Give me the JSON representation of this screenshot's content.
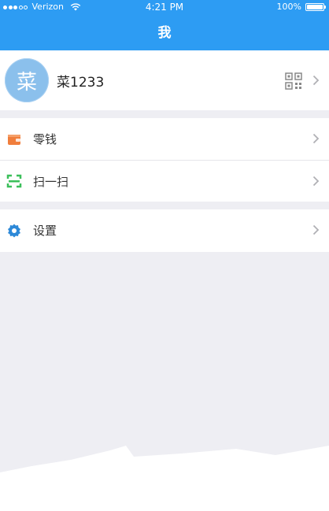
{
  "status_bar": {
    "carrier": "Verizon",
    "time": "4:21 PM",
    "battery": "100%"
  },
  "nav": {
    "title": "我"
  },
  "profile": {
    "avatar_text": "菜",
    "username": "菜1233",
    "qr_icon": "qr-code-icon"
  },
  "menu": {
    "wallet": {
      "label": "零钱",
      "icon": "wallet-icon",
      "color": "#f07e3c"
    },
    "scan": {
      "label": "扫一扫",
      "icon": "scan-icon",
      "color": "#3bbf5a"
    },
    "settings": {
      "label": "设置",
      "icon": "gear-icon",
      "color": "#2d89d8"
    }
  },
  "colors": {
    "nav_bg": "#2d9cf3",
    "page_bg": "#eeeef3",
    "avatar_bg": "#8bc0ec"
  }
}
